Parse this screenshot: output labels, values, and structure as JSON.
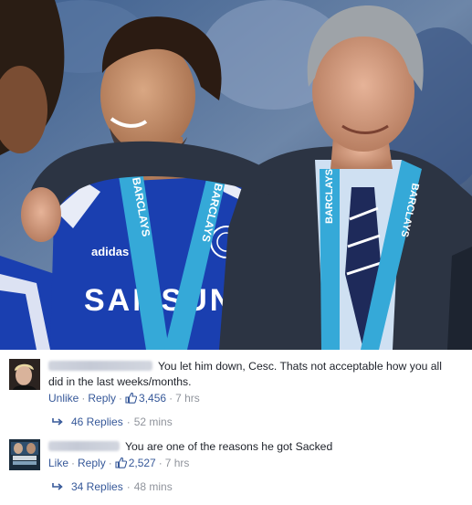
{
  "photo": {
    "alt_subjects": [
      "footballer-in-chelsea-kit",
      "manager-in-suit"
    ],
    "shirt_sponsor": "SAMSUNG",
    "medal_ribbon_text": "BARCLAYS",
    "colors": {
      "chelsea_blue": "#1a3fb0",
      "ribbon_blue": "#35a9d8",
      "suit": "#2c3443",
      "shirt": "#cfe0f2"
    }
  },
  "comments": [
    {
      "text": "You let him down, Cesc. Thats not acceptable how you all did in the last weeks/months.",
      "actions": {
        "like_label": "Unlike",
        "reply_label": "Reply",
        "like_count": "3,456",
        "time": "7 hrs"
      },
      "replies": {
        "label": "46 Replies",
        "time": "52 mins"
      }
    },
    {
      "text": "You are one of the reasons he got Sacked",
      "actions": {
        "like_label": "Like",
        "reply_label": "Reply",
        "like_count": "2,527",
        "time": "7 hrs"
      },
      "replies": {
        "label": "34 Replies",
        "time": "48 mins"
      }
    }
  ],
  "colors": {
    "link": "#365899",
    "text": "#1d2129",
    "meta": "#90949c"
  }
}
